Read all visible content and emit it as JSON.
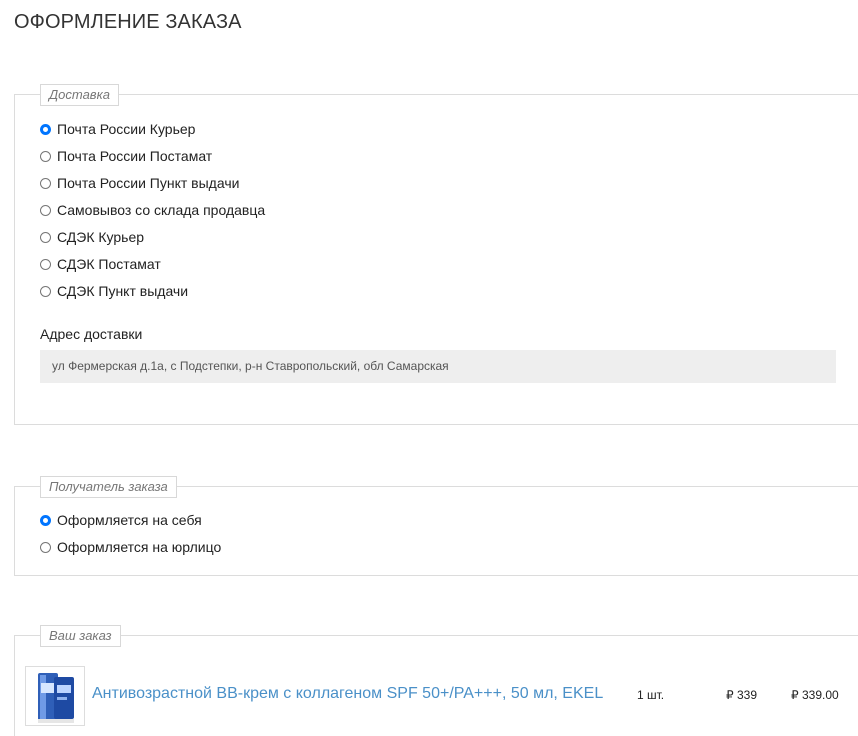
{
  "page": {
    "title": "ОФОРМЛЕНИЕ ЗАКАЗА"
  },
  "delivery": {
    "legend": "Доставка",
    "options": [
      {
        "label": "Почта России Курьер",
        "checked": true
      },
      {
        "label": "Почта России Постамат",
        "checked": false
      },
      {
        "label": "Почта России Пункт выдачи",
        "checked": false
      },
      {
        "label": "Самовывоз со склада продавца",
        "checked": false
      },
      {
        "label": "СДЭК Курьер",
        "checked": false
      },
      {
        "label": "СДЭК Постамат",
        "checked": false
      },
      {
        "label": "СДЭК Пункт выдачи",
        "checked": false
      }
    ],
    "address_label": "Адрес доставки",
    "address_value": "ул  Фермерская д.1а, с Подстепки, р-н Ставропольский, обл Самарская"
  },
  "recipient": {
    "legend": "Получатель заказа",
    "options": [
      {
        "label": "Оформляется на себя",
        "checked": true
      },
      {
        "label": "Оформляется на юрлицо",
        "checked": false
      }
    ]
  },
  "order": {
    "legend": "Ваш заказ",
    "items": [
      {
        "name": "Антивозрастной ВВ-крем с коллагеном SPF 50+/PA+++, 50 мл, EKEL",
        "quantity": "1 шт.",
        "price": "₽ 339",
        "total": "₽ 339.00",
        "image_icon": "product-tube-icon"
      }
    ]
  },
  "colors": {
    "accent": "#0075ff",
    "link": "#4a90c8",
    "border": "#dcdcdc",
    "input_bg": "#eeeeee"
  }
}
